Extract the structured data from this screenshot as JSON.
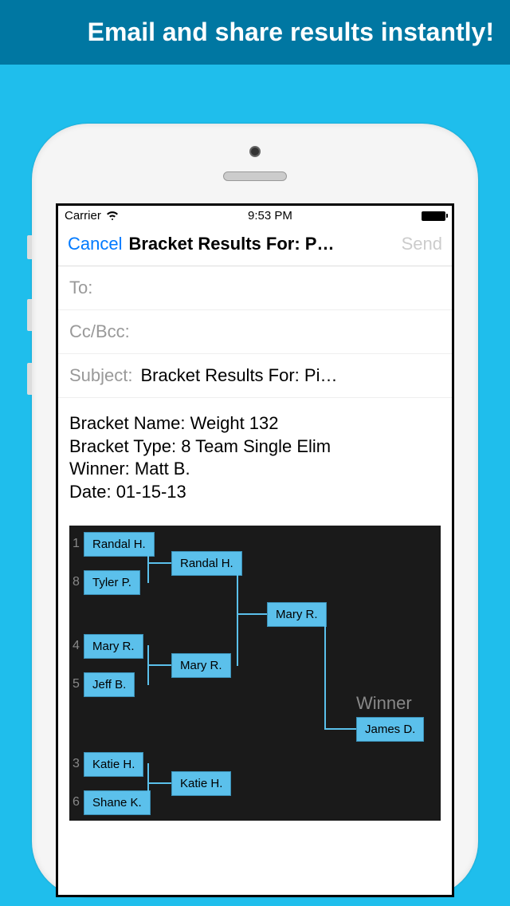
{
  "banner": "Email and share results instantly!",
  "statusBar": {
    "carrier": "Carrier",
    "time": "9:53 PM"
  },
  "nav": {
    "cancel": "Cancel",
    "title": "Bracket Results For: P…",
    "send": "Send"
  },
  "fields": {
    "toLabel": "To:",
    "ccLabel": "Cc/Bcc:",
    "subjectLabel": "Subject:",
    "subjectValue": "Bracket Results For: Pi…"
  },
  "body": {
    "line1": "Bracket Name: Weight 132",
    "line2": "Bracket Type: 8 Team Single Elim",
    "line3": "Winner: Matt B.",
    "line4": "Date: 01-15-13"
  },
  "bracket": {
    "seeds": [
      "1",
      "8",
      "4",
      "5",
      "3",
      "6"
    ],
    "round1": [
      "Randal H.",
      "Tyler P.",
      "Mary R.",
      "Jeff B.",
      "Katie H.",
      "Shane K."
    ],
    "round2": [
      "Randal H.",
      "Mary R.",
      "Katie H."
    ],
    "round3": [
      "Mary R."
    ],
    "winnerLabel": "Winner",
    "winnerName": "James D."
  }
}
